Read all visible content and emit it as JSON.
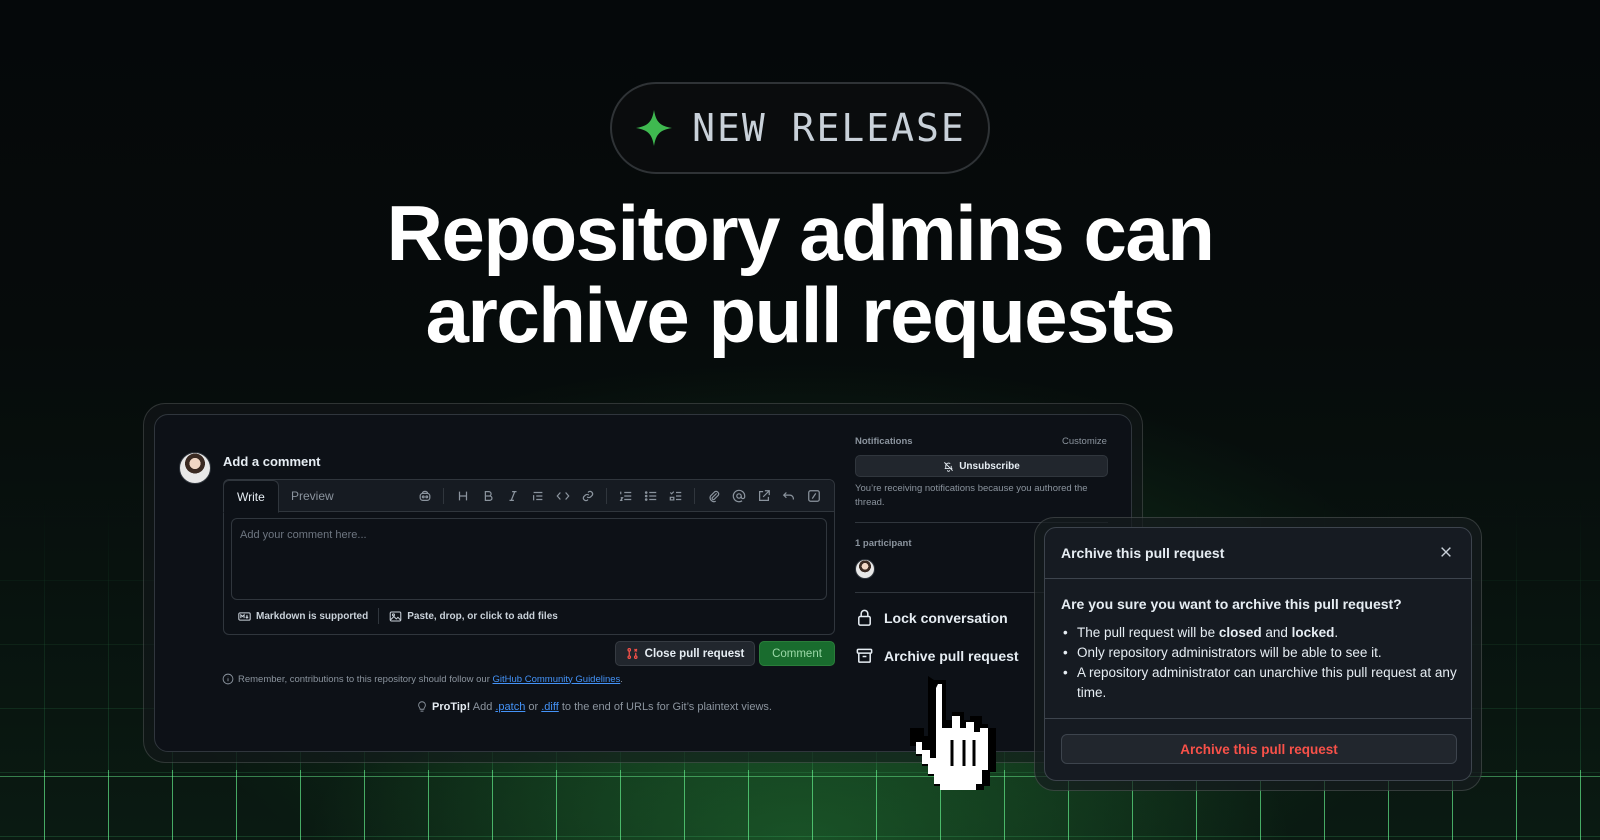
{
  "badge": {
    "label": "NEW RELEASE",
    "icon": "sparkle-icon",
    "accent": "#3fb950"
  },
  "headline": {
    "line1": "Repository admins can",
    "line2": "archive pull requests"
  },
  "comment": {
    "title": "Add a comment",
    "tabs": {
      "write": "Write",
      "preview": "Preview"
    },
    "placeholder": "Add your comment here...",
    "markdown": "Markdown is supported",
    "attach": "Paste, drop, or click to add files",
    "close_button": "Close pull request",
    "comment_button": "Comment",
    "remember_prefix": "Remember, contributions to this repository should follow our ",
    "remember_link": "GitHub Community Guidelines",
    "remember_suffix": ".",
    "protip_label": "ProTip!",
    "protip_add": " Add ",
    "protip_patch": ".patch",
    "protip_or": " or ",
    "protip_diff": ".diff",
    "protip_rest": " to the end of URLs for Git’s plaintext views."
  },
  "sidebar": {
    "notifications_title": "Notifications",
    "customize": "Customize",
    "unsubscribe": "Unsubscribe",
    "note": "You’re receiving notifications because you authored the thread.",
    "participants": "1 participant",
    "lock": "Lock conversation",
    "archive": "Archive pull request"
  },
  "dialog": {
    "title": "Archive this pull request",
    "question": "Are you sure you want to archive this pull request?",
    "b1_pre": "The pull request will be ",
    "b1_closed": "closed",
    "b1_and": " and ",
    "b1_locked": "locked",
    "b1_end": ".",
    "b2": "Only repository administrators will be able to see it.",
    "b3": "A repository administrator can unarchive this pull request at any time.",
    "confirm": "Archive this pull request",
    "danger_color": "#f85149"
  }
}
